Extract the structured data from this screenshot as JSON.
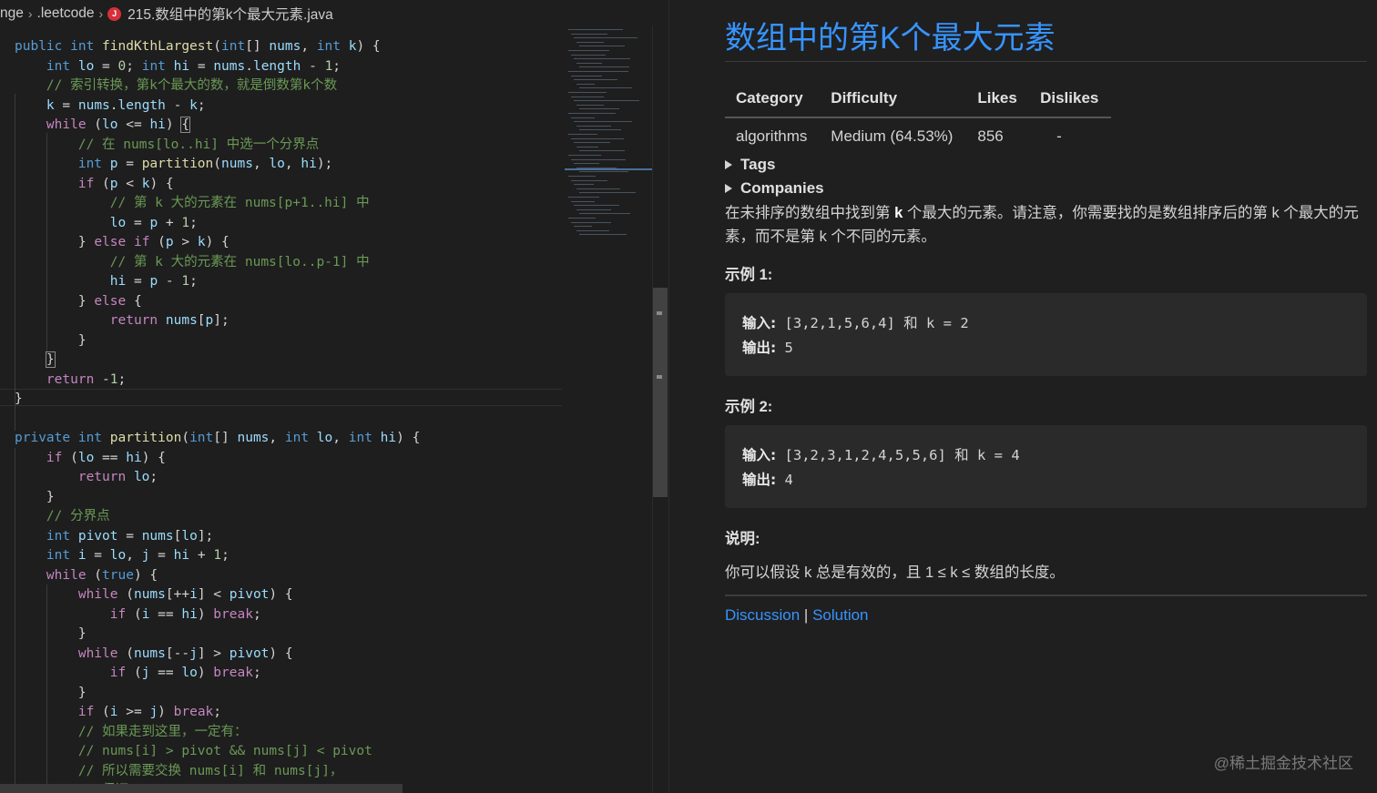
{
  "breadcrumb": {
    "part1": "nge",
    "part2": ".leetcode",
    "file_icon": "J",
    "file": "215.数组中的第k个最大元素.java"
  },
  "problem": {
    "title": "数组中的第K个最大元素",
    "table": {
      "headers": [
        "Category",
        "Difficulty",
        "Likes",
        "Dislikes"
      ],
      "values": [
        "algorithms",
        "Medium (64.53%)",
        "856",
        "-"
      ]
    },
    "tags_label": "Tags",
    "companies_label": "Companies",
    "desc_a": "在未排序的数组中找到第 ",
    "desc_k": "k",
    "desc_b": " 个最大的元素。请注意，你需要找的是数组排序后的第 k 个最大的元素，而不是第 k 个不同的元素。",
    "example1": {
      "title": "示例 1:",
      "in_label": "输入:",
      "in_value": " [3,2,1,5,6,4] 和 k = 2",
      "out_label": "输出:",
      "out_value": " 5"
    },
    "example2": {
      "title": "示例 2:",
      "in_label": "输入:",
      "in_value": " [3,2,3,1,2,4,5,5,6] 和 k = 4",
      "out_label": "输出:",
      "out_value": " 4"
    },
    "note_title": "说明:",
    "note_text": "你可以假设 k 总是有效的，且 1 ≤ k ≤ 数组的长度。",
    "links": {
      "discussion": "Discussion",
      "sep": " | ",
      "solution": "Solution"
    }
  },
  "watermark": "@稀土掘金技术社区",
  "code": [
    [
      [
        "kw",
        "public "
      ],
      [
        "kw",
        "int "
      ],
      [
        "fn",
        "findKthLargest"
      ],
      [
        "plain",
        "("
      ],
      [
        "kw",
        "int"
      ],
      [
        "plain",
        "[] "
      ],
      [
        "var",
        "nums"
      ],
      [
        "plain",
        ", "
      ],
      [
        "kw",
        "int "
      ],
      [
        "var",
        "k"
      ],
      [
        "plain",
        ") {"
      ]
    ],
    [
      [
        "plain",
        "    "
      ],
      [
        "kw",
        "int "
      ],
      [
        "var",
        "lo"
      ],
      [
        "plain",
        " = "
      ],
      [
        "num",
        "0"
      ],
      [
        "plain",
        "; "
      ],
      [
        "kw",
        "int "
      ],
      [
        "var",
        "hi"
      ],
      [
        "plain",
        " = "
      ],
      [
        "var",
        "nums"
      ],
      [
        "plain",
        "."
      ],
      [
        "var",
        "length"
      ],
      [
        "plain",
        " - "
      ],
      [
        "num",
        "1"
      ],
      [
        "plain",
        ";"
      ]
    ],
    [
      [
        "plain",
        "    "
      ],
      [
        "cm",
        "// 索引转换，第k个最大的数，就是倒数第k个数"
      ]
    ],
    [
      [
        "plain",
        "    "
      ],
      [
        "var",
        "k"
      ],
      [
        "plain",
        " = "
      ],
      [
        "var",
        "nums"
      ],
      [
        "plain",
        "."
      ],
      [
        "var",
        "length"
      ],
      [
        "plain",
        " - "
      ],
      [
        "var",
        "k"
      ],
      [
        "plain",
        ";"
      ]
    ],
    [
      [
        "plain",
        "    "
      ],
      [
        "kw2",
        "while"
      ],
      [
        "plain",
        " ("
      ],
      [
        "var",
        "lo"
      ],
      [
        "plain",
        " <= "
      ],
      [
        "var",
        "hi"
      ],
      [
        "plain",
        ") "
      ],
      [
        "box",
        "{"
      ]
    ],
    [
      [
        "plain",
        "        "
      ],
      [
        "cm",
        "// 在 nums[lo..hi] 中选一个分界点"
      ]
    ],
    [
      [
        "plain",
        "        "
      ],
      [
        "kw",
        "int "
      ],
      [
        "var",
        "p"
      ],
      [
        "plain",
        " = "
      ],
      [
        "fn",
        "partition"
      ],
      [
        "plain",
        "("
      ],
      [
        "var",
        "nums"
      ],
      [
        "plain",
        ", "
      ],
      [
        "var",
        "lo"
      ],
      [
        "plain",
        ", "
      ],
      [
        "var",
        "hi"
      ],
      [
        "plain",
        ");"
      ]
    ],
    [
      [
        "plain",
        "        "
      ],
      [
        "kw2",
        "if"
      ],
      [
        "plain",
        " ("
      ],
      [
        "var",
        "p"
      ],
      [
        "plain",
        " < "
      ],
      [
        "var",
        "k"
      ],
      [
        "plain",
        ") {"
      ]
    ],
    [
      [
        "plain",
        "            "
      ],
      [
        "cm",
        "// 第 k 大的元素在 nums[p+1..hi] 中"
      ]
    ],
    [
      [
        "plain",
        "            "
      ],
      [
        "var",
        "lo"
      ],
      [
        "plain",
        " = "
      ],
      [
        "var",
        "p"
      ],
      [
        "plain",
        " + "
      ],
      [
        "num",
        "1"
      ],
      [
        "plain",
        ";"
      ]
    ],
    [
      [
        "plain",
        "        } "
      ],
      [
        "kw2",
        "else if"
      ],
      [
        "plain",
        " ("
      ],
      [
        "var",
        "p"
      ],
      [
        "plain",
        " > "
      ],
      [
        "var",
        "k"
      ],
      [
        "plain",
        ") {"
      ]
    ],
    [
      [
        "plain",
        "            "
      ],
      [
        "cm",
        "// 第 k 大的元素在 nums[lo..p-1] 中"
      ]
    ],
    [
      [
        "plain",
        "            "
      ],
      [
        "var",
        "hi"
      ],
      [
        "plain",
        " = "
      ],
      [
        "var",
        "p"
      ],
      [
        "plain",
        " - "
      ],
      [
        "num",
        "1"
      ],
      [
        "plain",
        ";"
      ]
    ],
    [
      [
        "plain",
        "        } "
      ],
      [
        "kw2",
        "else"
      ],
      [
        "plain",
        " {"
      ]
    ],
    [
      [
        "plain",
        "            "
      ],
      [
        "kw2",
        "return "
      ],
      [
        "var",
        "nums"
      ],
      [
        "plain",
        "["
      ],
      [
        "var",
        "p"
      ],
      [
        "plain",
        "];"
      ]
    ],
    [
      [
        "plain",
        "        }"
      ]
    ],
    [
      [
        "plain",
        "    "
      ],
      [
        "box",
        "}"
      ]
    ],
    [
      [
        "plain",
        "    "
      ],
      [
        "kw2",
        "return"
      ],
      [
        "plain",
        " -"
      ],
      [
        "num",
        "1"
      ],
      [
        "plain",
        ";"
      ]
    ],
    [
      [
        "plain",
        "}"
      ]
    ],
    [
      [
        "plain",
        ""
      ]
    ],
    [
      [
        "kw",
        "private "
      ],
      [
        "kw",
        "int "
      ],
      [
        "fn",
        "partition"
      ],
      [
        "plain",
        "("
      ],
      [
        "kw",
        "int"
      ],
      [
        "plain",
        "[] "
      ],
      [
        "var",
        "nums"
      ],
      [
        "plain",
        ", "
      ],
      [
        "kw",
        "int "
      ],
      [
        "var",
        "lo"
      ],
      [
        "plain",
        ", "
      ],
      [
        "kw",
        "int "
      ],
      [
        "var",
        "hi"
      ],
      [
        "plain",
        ") {"
      ]
    ],
    [
      [
        "plain",
        "    "
      ],
      [
        "kw2",
        "if"
      ],
      [
        "plain",
        " ("
      ],
      [
        "var",
        "lo"
      ],
      [
        "plain",
        " == "
      ],
      [
        "var",
        "hi"
      ],
      [
        "plain",
        ") {"
      ]
    ],
    [
      [
        "plain",
        "        "
      ],
      [
        "kw2",
        "return "
      ],
      [
        "var",
        "lo"
      ],
      [
        "plain",
        ";"
      ]
    ],
    [
      [
        "plain",
        "    }"
      ]
    ],
    [
      [
        "plain",
        "    "
      ],
      [
        "cm",
        "// 分界点"
      ]
    ],
    [
      [
        "plain",
        "    "
      ],
      [
        "kw",
        "int "
      ],
      [
        "var",
        "pivot"
      ],
      [
        "plain",
        " = "
      ],
      [
        "var",
        "nums"
      ],
      [
        "plain",
        "["
      ],
      [
        "var",
        "lo"
      ],
      [
        "plain",
        "];"
      ]
    ],
    [
      [
        "plain",
        "    "
      ],
      [
        "kw",
        "int "
      ],
      [
        "var",
        "i"
      ],
      [
        "plain",
        " = "
      ],
      [
        "var",
        "lo"
      ],
      [
        "plain",
        ", "
      ],
      [
        "var",
        "j"
      ],
      [
        "plain",
        " = "
      ],
      [
        "var",
        "hi"
      ],
      [
        "plain",
        " + "
      ],
      [
        "num",
        "1"
      ],
      [
        "plain",
        ";"
      ]
    ],
    [
      [
        "plain",
        "    "
      ],
      [
        "kw2",
        "while"
      ],
      [
        "plain",
        " ("
      ],
      [
        "kw",
        "true"
      ],
      [
        "plain",
        ") {"
      ]
    ],
    [
      [
        "plain",
        "        "
      ],
      [
        "kw2",
        "while"
      ],
      [
        "plain",
        " ("
      ],
      [
        "var",
        "nums"
      ],
      [
        "plain",
        "[++"
      ],
      [
        "var",
        "i"
      ],
      [
        "plain",
        "] < "
      ],
      [
        "var",
        "pivot"
      ],
      [
        "plain",
        ") {"
      ]
    ],
    [
      [
        "plain",
        "            "
      ],
      [
        "kw2",
        "if"
      ],
      [
        "plain",
        " ("
      ],
      [
        "var",
        "i"
      ],
      [
        "plain",
        " == "
      ],
      [
        "var",
        "hi"
      ],
      [
        "plain",
        ") "
      ],
      [
        "kw2",
        "break"
      ],
      [
        "plain",
        ";"
      ]
    ],
    [
      [
        "plain",
        "        }"
      ]
    ],
    [
      [
        "plain",
        "        "
      ],
      [
        "kw2",
        "while"
      ],
      [
        "plain",
        " ("
      ],
      [
        "var",
        "nums"
      ],
      [
        "plain",
        "[--"
      ],
      [
        "var",
        "j"
      ],
      [
        "plain",
        "] > "
      ],
      [
        "var",
        "pivot"
      ],
      [
        "plain",
        ") {"
      ]
    ],
    [
      [
        "plain",
        "            "
      ],
      [
        "kw2",
        "if"
      ],
      [
        "plain",
        " ("
      ],
      [
        "var",
        "j"
      ],
      [
        "plain",
        " == "
      ],
      [
        "var",
        "lo"
      ],
      [
        "plain",
        ") "
      ],
      [
        "kw2",
        "break"
      ],
      [
        "plain",
        ";"
      ]
    ],
    [
      [
        "plain",
        "        }"
      ]
    ],
    [
      [
        "plain",
        "        "
      ],
      [
        "kw2",
        "if"
      ],
      [
        "plain",
        " ("
      ],
      [
        "var",
        "i"
      ],
      [
        "plain",
        " >= "
      ],
      [
        "var",
        "j"
      ],
      [
        "plain",
        ") "
      ],
      [
        "kw2",
        "break"
      ],
      [
        "plain",
        ";"
      ]
    ],
    [
      [
        "plain",
        "        "
      ],
      [
        "cm",
        "// 如果走到这里，一定有："
      ]
    ],
    [
      [
        "plain",
        "        "
      ],
      [
        "cm",
        "// nums[i] > pivot && nums[j] < pivot"
      ]
    ],
    [
      [
        "plain",
        "        "
      ],
      [
        "cm",
        "// 所以需要交换 nums[i] 和 nums[j]，"
      ]
    ],
    [
      [
        "plain",
        "        "
      ],
      [
        "cm",
        "// 保证 nums[lo..i] < pivot < nums[j..hi]"
      ]
    ]
  ]
}
